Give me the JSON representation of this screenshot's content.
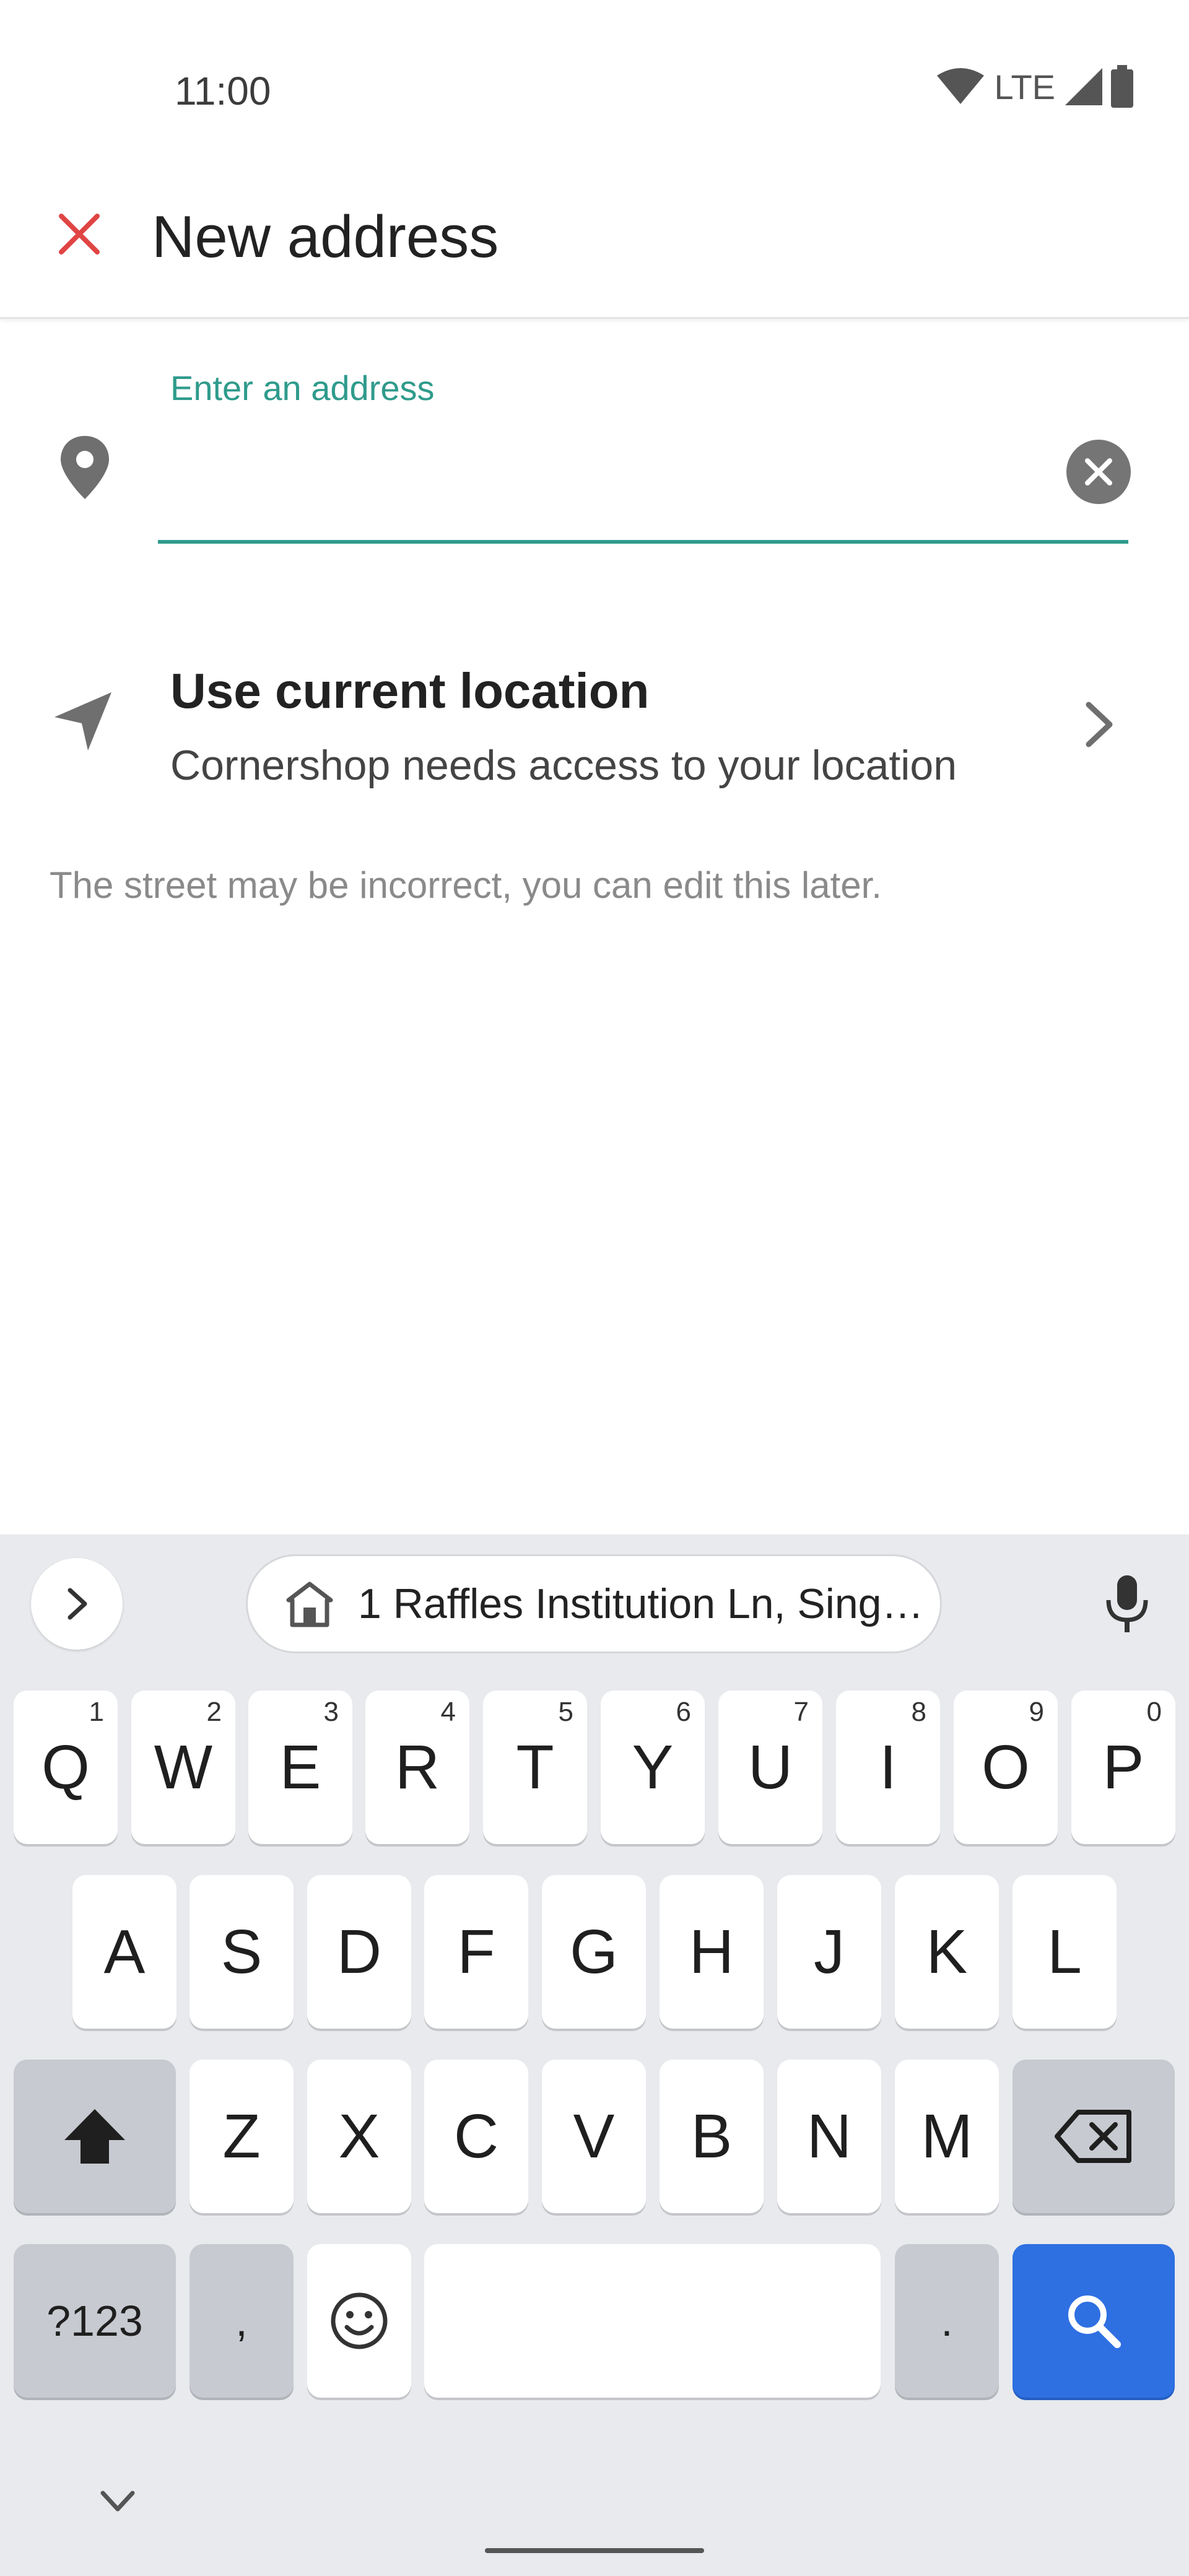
{
  "status_bar": {
    "time": "11:00",
    "network": "LTE"
  },
  "header": {
    "title": "New address"
  },
  "address_field": {
    "label": "Enter an address",
    "value": "",
    "placeholder": ""
  },
  "current_location": {
    "title": "Use current location",
    "subtitle": "Cornershop needs access to your location"
  },
  "hint": "The street may be incorrect, you can edit this later.",
  "keyboard": {
    "suggestion": "1 Raffles Institution Ln, Sing…",
    "row1": [
      {
        "label": "Q",
        "sup": "1"
      },
      {
        "label": "W",
        "sup": "2"
      },
      {
        "label": "E",
        "sup": "3"
      },
      {
        "label": "R",
        "sup": "4"
      },
      {
        "label": "T",
        "sup": "5"
      },
      {
        "label": "Y",
        "sup": "6"
      },
      {
        "label": "U",
        "sup": "7"
      },
      {
        "label": "I",
        "sup": "8"
      },
      {
        "label": "O",
        "sup": "9"
      },
      {
        "label": "P",
        "sup": "0"
      }
    ],
    "row2": [
      "A",
      "S",
      "D",
      "F",
      "G",
      "H",
      "J",
      "K",
      "L"
    ],
    "row3": [
      "Z",
      "X",
      "C",
      "V",
      "B",
      "N",
      "M"
    ],
    "symbols_label": "?123",
    "comma_label": ",",
    "period_label": "."
  },
  "colors": {
    "accent": "#2f9b8c",
    "close": "#e04545",
    "search_key": "#2e6fe2"
  },
  "icons": {
    "close": "close-icon",
    "pin": "location-pin-icon",
    "clear": "clear-icon",
    "navigation": "navigation-arrow-icon",
    "chevron": "chevron-right-icon",
    "home": "home-icon",
    "mic": "microphone-icon",
    "shift": "shift-icon",
    "backspace": "backspace-icon",
    "emoji": "emoji-icon",
    "search": "search-icon"
  }
}
